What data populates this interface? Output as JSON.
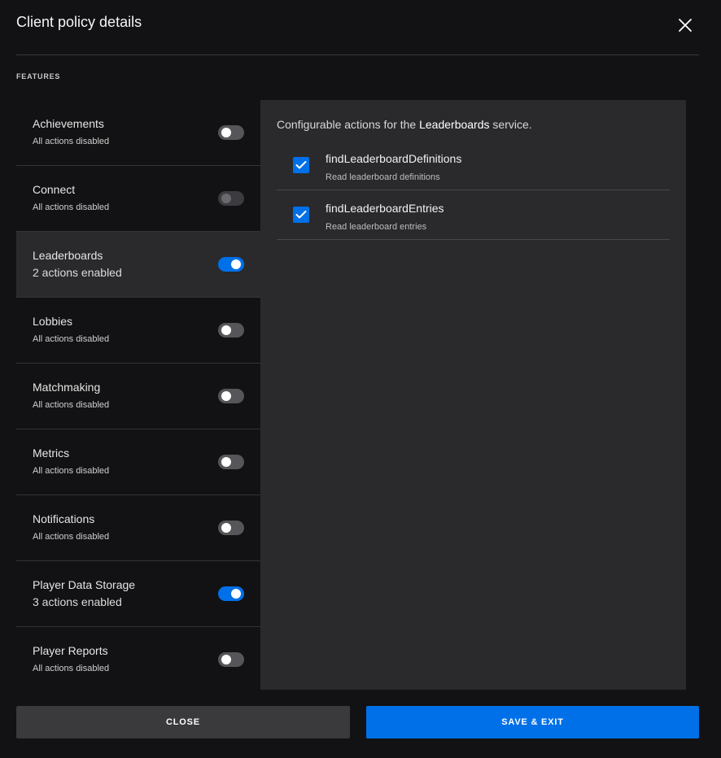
{
  "dialog": {
    "title": "Client policy details",
    "section_label": "FEATURES"
  },
  "features": [
    {
      "name": "Achievements",
      "status": "All actions disabled",
      "toggle": "off"
    },
    {
      "name": "Connect",
      "status": "All actions disabled",
      "toggle": "disabled"
    },
    {
      "name": "Leaderboards",
      "status": "2 actions enabled",
      "toggle": "on",
      "selected": true
    },
    {
      "name": "Lobbies",
      "status": "All actions disabled",
      "toggle": "off"
    },
    {
      "name": "Matchmaking",
      "status": "All actions disabled",
      "toggle": "off"
    },
    {
      "name": "Metrics",
      "status": "All actions disabled",
      "toggle": "off"
    },
    {
      "name": "Notifications",
      "status": "All actions disabled",
      "toggle": "off"
    },
    {
      "name": "Player Data Storage",
      "status": "3 actions enabled",
      "toggle": "on"
    },
    {
      "name": "Player Reports",
      "status": "All actions disabled",
      "toggle": "off"
    }
  ],
  "panel": {
    "intro_prefix": "Configurable actions for the",
    "intro_service": "Leaderboards",
    "intro_suffix": "service.",
    "actions": [
      {
        "name": "findLeaderboardDefinitions",
        "description": "Read leaderboard definitions",
        "checked": true
      },
      {
        "name": "findLeaderboardEntries",
        "description": "Read leaderboard entries",
        "checked": true
      }
    ]
  },
  "buttons": {
    "close_label": "CLOSE",
    "save_label": "SAVE & EXIT"
  },
  "colors": {
    "accent": "#0070e8",
    "background": "#121214",
    "panel": "#2a2a2d"
  },
  "icons": {
    "close": "close-icon",
    "check": "checkmark-icon"
  }
}
